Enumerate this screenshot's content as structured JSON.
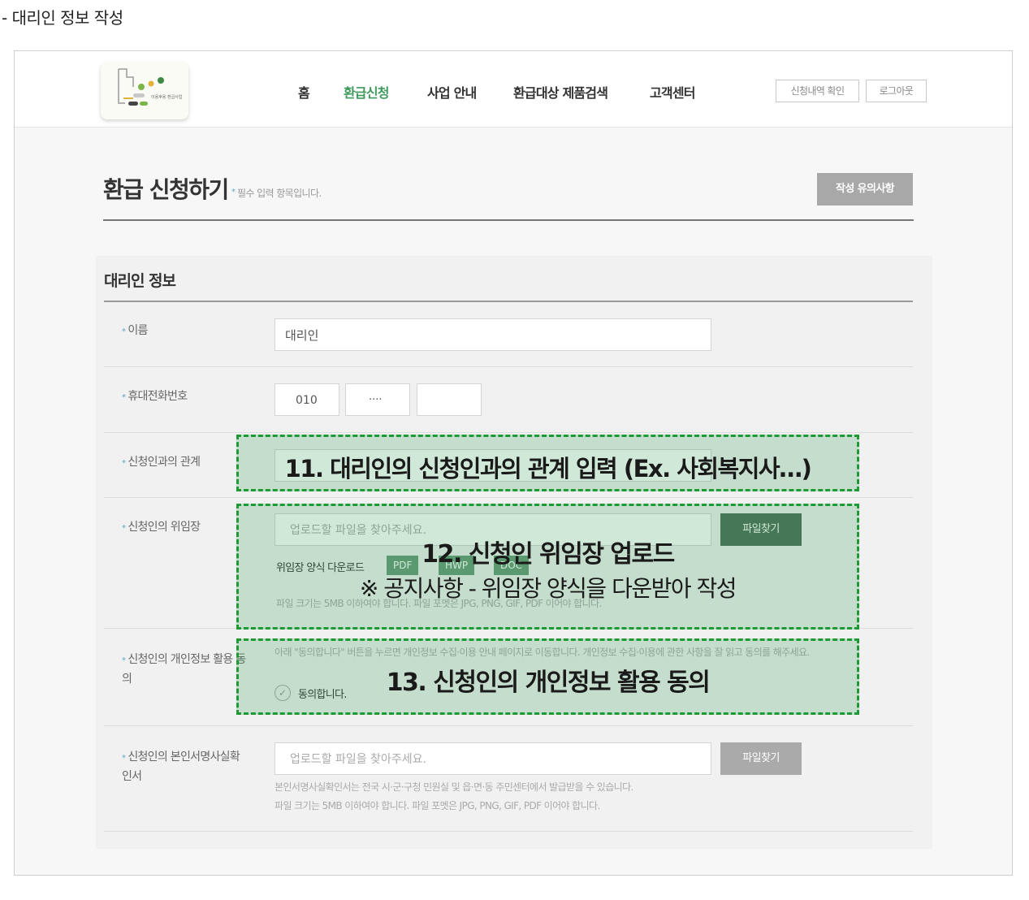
{
  "doc_heading": "- 대리인 정보 작성",
  "header": {
    "logo_text": "이용후용 환급사업",
    "nav": [
      "홈",
      "환급신청",
      "사업 안내",
      "환급대상 제품검색",
      "고객센터"
    ],
    "buttons": {
      "history": "신청내역 확인",
      "logout": "로그아웃"
    }
  },
  "page": {
    "title": "환급 신청하기",
    "required_marker": "*",
    "subtitle": "필수 입력 항목입니다.",
    "notice_button": "작성 유의사항"
  },
  "section": {
    "title": "대리인 정보",
    "fields": {
      "name": {
        "label": "이름",
        "value": "대리인"
      },
      "phone": {
        "label": "휴대전화번호",
        "part1": "010",
        "part2": "····",
        "part3": ""
      },
      "relation": {
        "label": "신청인과의 관계"
      },
      "proxy_doc": {
        "label": "신청인의 위임장",
        "placeholder": "업로드할 파일을 찾아주세요.",
        "file_button": "파일찾기",
        "download_label": "위임장 양식 다운로드",
        "download_buttons": [
          "PDF",
          "HWP",
          "DOC"
        ],
        "note": "파일 크기는 5MB 이하여야 합니다. 파일 포멧은 JPG, PNG, GIF, PDF 이어야 합니다."
      },
      "consent": {
        "label": "신청인의 개인정보 활용 동의",
        "description": "아래 \"동의합니다\" 버튼을 누르면 개인정보 수집·이용 안내 페이지로 이동합니다. 개인정보 수집·이용에 관한 사항을 잘 읽고 동의를 해주세요.",
        "agree_label": "동의합니다."
      },
      "signature": {
        "label": "신청인의 본인서명사실확인서",
        "placeholder": "업로드할 파일을 찾아주세요.",
        "file_button": "파일찾기",
        "note1": "본인서명사실확인서는 전국 시·군·구청 민원실 및 읍·면·동 주민센터에서 발급받을 수 있습니다.",
        "note2": "파일 크기는 5MB 이하여야 합니다. 파일 포멧은 JPG, PNG, GIF, PDF 이어야 합니다."
      }
    }
  },
  "callouts": {
    "c11": "11. 대리인의 신청인과의 관계 입력 (Ex. 사회복지사…)",
    "c12_line1": "12. 신청인 위임장 업로드",
    "c12_line2": "※ 공지사항 - 위임장 양식을 다운받아 작성",
    "c13": "13. 신청인의 개인정보 활용 동의"
  },
  "colors": {
    "accent_green": "#3f9a5e",
    "callout_border": "#1e9a35",
    "required_blue": "#5aa7c6"
  }
}
